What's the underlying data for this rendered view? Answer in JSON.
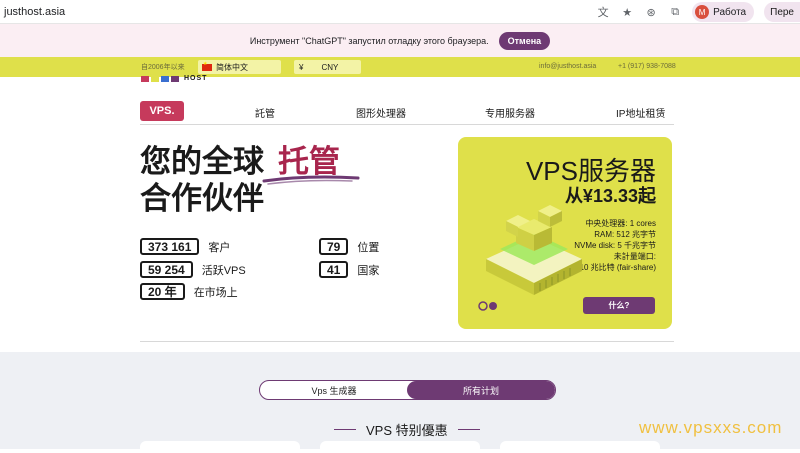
{
  "browser": {
    "url": "justhost.asia",
    "profile_initial": "M",
    "profile_label": "Работа",
    "extra_label": "Пере"
  },
  "debug_banner": {
    "text": "Инструмент \"ChatGPT\" запустил отладку этого браузера.",
    "button": "Отмена"
  },
  "top_strip": {
    "since": "自2006年以来",
    "language": "简体中文",
    "currency_symbol": "¥",
    "currency_code": "CNY",
    "email": "info@justhost.asia",
    "phone": "+1 (917) 938-7088"
  },
  "logo": {
    "text": "HOST"
  },
  "nav": {
    "vps": "VPS.",
    "items": [
      "託管",
      "图形处理器",
      "专用服务器",
      "IP地址租赁"
    ]
  },
  "hero": {
    "line1_a": "您的全球",
    "line1_b": "托管",
    "line2": "合作伙伴"
  },
  "stats": [
    {
      "value": "373 161",
      "label": "客户"
    },
    {
      "value": "79",
      "label": "位置"
    },
    {
      "value": "59 254",
      "label": "活跃VPS"
    },
    {
      "value": "41",
      "label": "国家"
    },
    {
      "value": "20 年",
      "label": "在市场上"
    }
  ],
  "promo": {
    "title": "VPS服务器",
    "price": "从¥13.33起",
    "specs": [
      "中央处理器: 1 cores",
      "RAM: 512 兆字节",
      "NVMe disk: 5 千兆字节",
      "未計量端口:",
      "10 兆比特 (fair-share)"
    ],
    "button": "什么?"
  },
  "lower": {
    "tab_a": "Vps 生成器",
    "tab_b": "所有计划",
    "section_title": "VPS 特别優惠"
  },
  "watermark": "www.vpsxxs.com",
  "colors": {
    "accent_yellow": "#dfe04a",
    "accent_purple": "#6e3a73",
    "accent_red": "#c63a5c",
    "hero_accent": "#a8254d"
  }
}
